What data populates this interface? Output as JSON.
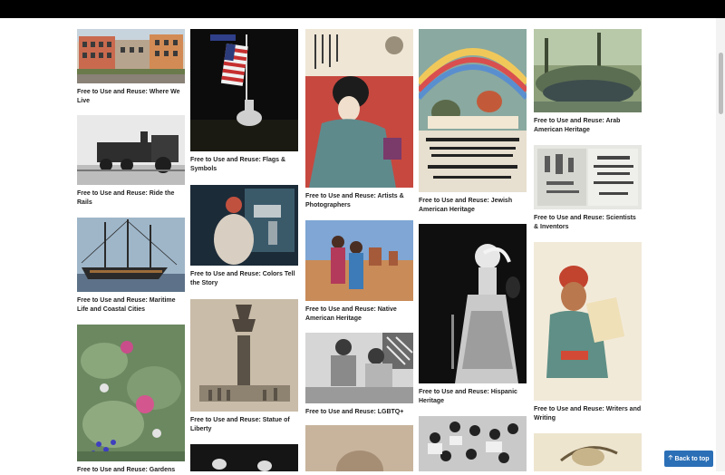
{
  "collections": [
    {
      "id": "where-we-live",
      "caption": "Free to Use and Reuse: Where We Live"
    },
    {
      "id": "ride-the-rails",
      "caption": "Free to Use and Reuse: Ride the Rails"
    },
    {
      "id": "maritime",
      "caption": "Free to Use and Reuse: Maritime Life and Coastal Cities"
    },
    {
      "id": "gardens",
      "caption": "Free to Use and Reuse: Gardens"
    },
    {
      "id": "flags",
      "caption": "Free to Use and Reuse: Flags & Symbols"
    },
    {
      "id": "colors",
      "caption": "Free to Use and Reuse: Colors Tell the Story"
    },
    {
      "id": "liberty",
      "caption": "Free to Use and Reuse: Statue of Liberty"
    },
    {
      "id": "artists",
      "caption": "Free to Use and Reuse: Artists & Photographers"
    },
    {
      "id": "native",
      "caption": "Free to Use and Reuse: Native American Heritage"
    },
    {
      "id": "lgbtq",
      "caption": "Free to Use and Reuse: LGBTQ+"
    },
    {
      "id": "jewish",
      "caption": "Free to Use and Reuse: Jewish American Heritage"
    },
    {
      "id": "hispanic",
      "caption": "Free to Use and Reuse: Hispanic Heritage"
    },
    {
      "id": "arab",
      "caption": "Free to Use and Reuse: Arab American Heritage"
    },
    {
      "id": "scientists",
      "caption": "Free to Use and Reuse: Scientists & Inventors"
    },
    {
      "id": "writers",
      "caption": "Free to Use and Reuse: Writers and Writing"
    }
  ],
  "back_to_top": {
    "label": "Back to top",
    "icon": "arrow-up-icon"
  }
}
